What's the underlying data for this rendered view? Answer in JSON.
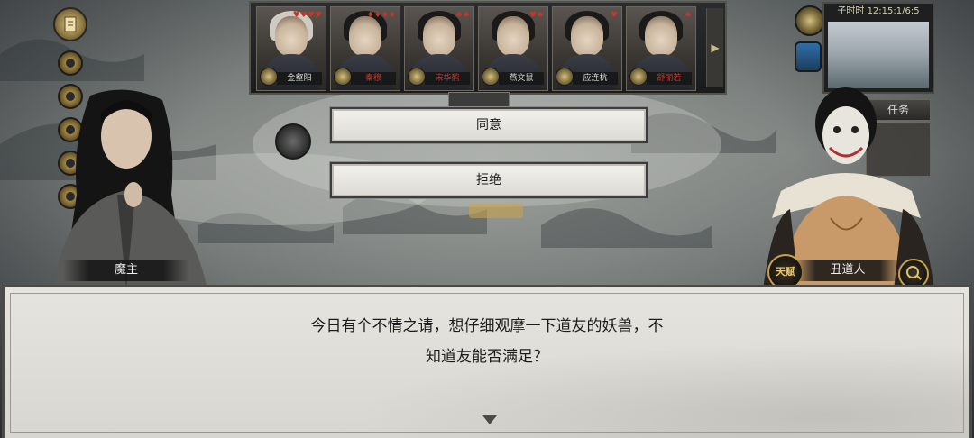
{
  "roster": {
    "members": [
      {
        "name": "金壑阳",
        "suits": "♥♥♥♥",
        "name_color": "normal",
        "hair": "white"
      },
      {
        "name": "秦穆",
        "suits": "♦♦♦♦",
        "name_color": "red",
        "hair": "black"
      },
      {
        "name": "宋华鹤",
        "suits": "♠♠",
        "name_color": "red",
        "hair": "black"
      },
      {
        "name": "燕文鼠",
        "suits": "♥♠",
        "name_color": "normal",
        "hair": "black"
      },
      {
        "name": "应连杭",
        "suits": "♥",
        "name_color": "normal",
        "hair": "black"
      },
      {
        "name": "舒丽若",
        "suits": "♠",
        "name_color": "red",
        "hair": "black"
      }
    ],
    "arrow_icon": "triangle-right-icon"
  },
  "small_tab": "",
  "minimap": {
    "time": "子时时 12:15:1/6:5"
  },
  "right_tab": {
    "label": "任务"
  },
  "choices": [
    {
      "label": "同意"
    },
    {
      "label": "拒绝"
    }
  ],
  "speaker_left": {
    "name": "魔主"
  },
  "speaker_right": {
    "name": "丑道人",
    "badge": "天赋"
  },
  "dialogue": {
    "line1": "今日有个不情之请，想仔细观摩一下道友的妖兽，不",
    "line2": "知道友能否满足？"
  },
  "colors": {
    "dialog_bg": "#e2e0da",
    "button_bg": "#ecebe6",
    "accent_gold": "#c8a24a",
    "suit_red": "#c0392b"
  }
}
